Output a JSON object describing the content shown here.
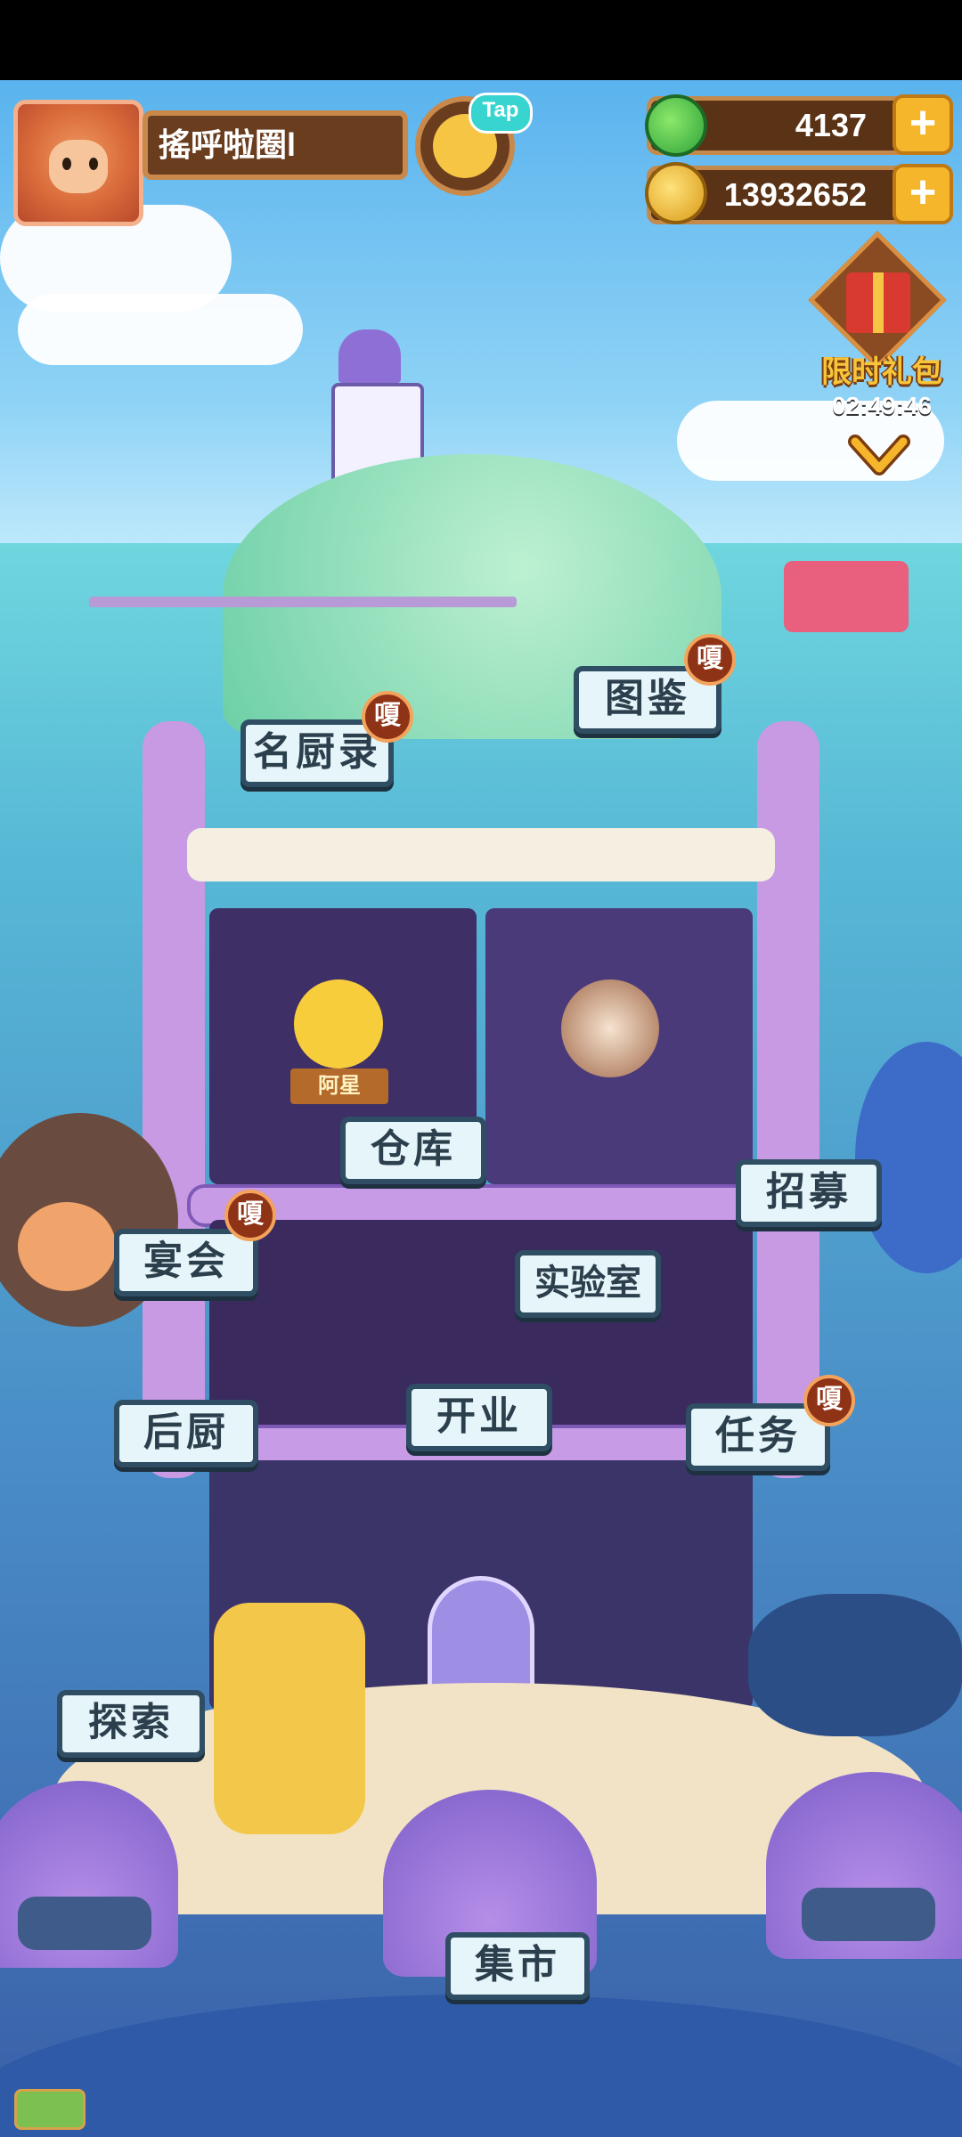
{
  "player": {
    "name": "搖呼啦圈l"
  },
  "tap_badge": "Tap",
  "resources": {
    "gems": "4137",
    "coins": "13932652",
    "plus": "+"
  },
  "gift": {
    "label": "限时礼包",
    "timer": "02:49:46"
  },
  "buildings": {
    "chef_records": "名厨录",
    "collection": "图鉴",
    "warehouse": "仓库",
    "recruit": "招募",
    "banquet": "宴会",
    "laboratory": "实验室",
    "kitchen": "后厨",
    "open_business": "开业",
    "tasks": "任务",
    "explore": "探索",
    "market": "集市"
  },
  "badge_text": "嗄",
  "trophy_plate": "阿星",
  "colors": {
    "sign_bg": "#e6f5f9",
    "sign_border": "#2f4e63",
    "badge": "#8f3317",
    "gold": "#f6b62c"
  }
}
